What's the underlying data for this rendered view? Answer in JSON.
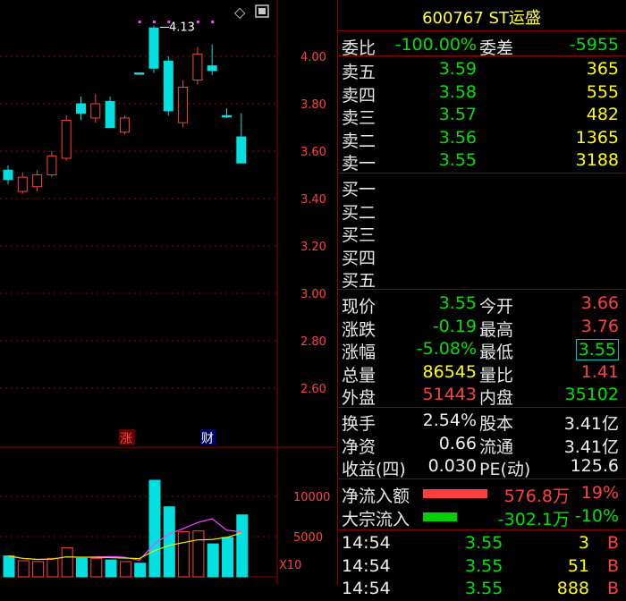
{
  "colors": {
    "up": "#ff4040",
    "down": "#00e0e0",
    "ma5": "#ff40ff",
    "ma10": "#e8e800",
    "grid": "#8a0000",
    "axis_text": "#ff4040"
  },
  "chart": {
    "price_ticks": [
      "4.00",
      "3.80",
      "3.60",
      "3.40",
      "3.20",
      "3.00",
      "2.80",
      "2.60"
    ],
    "high_label": "4.13",
    "markers": {
      "zhang": "涨",
      "cai": "财"
    },
    "volume_ticks": [
      "10000",
      "5000"
    ],
    "volume_unit": "X10",
    "icons": {
      "diamond": "◇",
      "window": "window-icon"
    }
  },
  "chart_data": {
    "type": "candlestick",
    "ylim": [
      2.5,
      4.2
    ],
    "candles": [
      {
        "o": 3.48,
        "c": 3.52,
        "h": 3.54,
        "l": 3.46,
        "up": false
      },
      {
        "o": 3.43,
        "c": 3.49,
        "h": 3.51,
        "l": 3.42,
        "up": true
      },
      {
        "o": 3.45,
        "c": 3.5,
        "h": 3.52,
        "l": 3.43,
        "up": true
      },
      {
        "o": 3.5,
        "c": 3.58,
        "h": 3.6,
        "l": 3.49,
        "up": true
      },
      {
        "o": 3.57,
        "c": 3.73,
        "h": 3.75,
        "l": 3.56,
        "up": true
      },
      {
        "o": 3.8,
        "c": 3.76,
        "h": 3.83,
        "l": 3.73,
        "up": false
      },
      {
        "o": 3.74,
        "c": 3.8,
        "h": 3.84,
        "l": 3.72,
        "up": true
      },
      {
        "o": 3.81,
        "c": 3.7,
        "h": 3.83,
        "l": 3.7,
        "up": false
      },
      {
        "o": 3.68,
        "c": 3.74,
        "h": 3.75,
        "l": 3.67,
        "up": true
      },
      {
        "o": 3.93,
        "c": 3.93,
        "h": 3.93,
        "l": 3.93,
        "up": false
      },
      {
        "o": 4.12,
        "c": 3.95,
        "h": 4.13,
        "l": 3.93,
        "up": false
      },
      {
        "o": 3.98,
        "c": 3.77,
        "h": 4.0,
        "l": 3.75,
        "up": false
      },
      {
        "o": 3.72,
        "c": 3.87,
        "h": 3.9,
        "l": 3.7,
        "up": true
      },
      {
        "o": 3.9,
        "c": 4.01,
        "h": 4.04,
        "l": 3.88,
        "up": true
      },
      {
        "o": 3.96,
        "c": 3.94,
        "h": 4.05,
        "l": 3.92,
        "up": false
      },
      {
        "o": 3.75,
        "c": 3.75,
        "h": 3.78,
        "l": 3.74,
        "up": false
      },
      {
        "o": 3.66,
        "c": 3.55,
        "h": 3.76,
        "l": 3.55,
        "up": false
      }
    ],
    "volumes": [
      {
        "v": 2600,
        "up": false
      },
      {
        "v": 2000,
        "up": true
      },
      {
        "v": 1900,
        "up": true
      },
      {
        "v": 2300,
        "up": true
      },
      {
        "v": 3600,
        "up": true
      },
      {
        "v": 2300,
        "up": false
      },
      {
        "v": 2300,
        "up": true
      },
      {
        "v": 2100,
        "up": false
      },
      {
        "v": 1900,
        "up": true
      },
      {
        "v": 1700,
        "up": false
      },
      {
        "v": 12000,
        "up": false
      },
      {
        "v": 8700,
        "up": false
      },
      {
        "v": 5600,
        "up": true
      },
      {
        "v": 5700,
        "up": true
      },
      {
        "v": 4100,
        "up": false
      },
      {
        "v": 4900,
        "up": false
      },
      {
        "v": 7700,
        "up": false
      }
    ],
    "vol_ylim": [
      0,
      14000
    ]
  },
  "quote": {
    "title": "600767 ST运盛",
    "weibi": {
      "label": "委比",
      "value": "-100.00%",
      "label2": "委差",
      "value2": "-5955"
    },
    "asks": [
      {
        "label": "卖五",
        "price": "3.59",
        "vol": "365"
      },
      {
        "label": "卖四",
        "price": "3.58",
        "vol": "555"
      },
      {
        "label": "卖三",
        "price": "3.57",
        "vol": "482"
      },
      {
        "label": "卖二",
        "price": "3.56",
        "vol": "1365"
      },
      {
        "label": "卖一",
        "price": "3.55",
        "vol": "3188"
      }
    ],
    "bids": [
      {
        "label": "买一"
      },
      {
        "label": "买二"
      },
      {
        "label": "买三"
      },
      {
        "label": "买四"
      },
      {
        "label": "买五"
      }
    ],
    "stats": [
      {
        "l1": "现价",
        "v1": "3.55",
        "l2": "今开",
        "v2": "3.66",
        "c1": "green",
        "c2": "red"
      },
      {
        "l1": "涨跌",
        "v1": "-0.19",
        "l2": "最高",
        "v2": "3.76",
        "c1": "green",
        "c2": "red"
      },
      {
        "l1": "涨幅",
        "v1": "-5.08%",
        "l2": "最低",
        "v2": "3.55",
        "c1": "green",
        "c2": "green"
      },
      {
        "l1": "总量",
        "v1": "86545",
        "l2": "量比",
        "v2": "1.41",
        "c1": "yellow",
        "c2": "red"
      },
      {
        "l1": "外盘",
        "v1": "51443",
        "l2": "内盘",
        "v2": "35102",
        "c1": "red",
        "c2": "green"
      }
    ],
    "fund": [
      {
        "l1": "换手",
        "v1": "2.54%",
        "l2": "股本",
        "v2": "3.41亿"
      },
      {
        "l1": "净资",
        "v1": "0.66",
        "l2": "流通",
        "v2": "3.41亿"
      },
      {
        "l1": "收益(四)",
        "v1": "0.030",
        "l2": "PE(动)",
        "v2": "125.6"
      }
    ],
    "flows": [
      {
        "label": "净流入额",
        "value": "576.8万",
        "pct": "19%",
        "color": "#ff4040",
        "c": "red"
      },
      {
        "label": "大宗流入",
        "value": "-302.1万",
        "pct": "-10%",
        "color": "#00d000",
        "c": "green"
      }
    ],
    "ticks": [
      {
        "time": "14:54",
        "price": "3.55",
        "vol": "3",
        "side": "B"
      },
      {
        "time": "14:54",
        "price": "3.55",
        "vol": "51",
        "side": "B"
      },
      {
        "time": "14:54",
        "price": "3.55",
        "vol": "888",
        "side": "B"
      }
    ]
  }
}
